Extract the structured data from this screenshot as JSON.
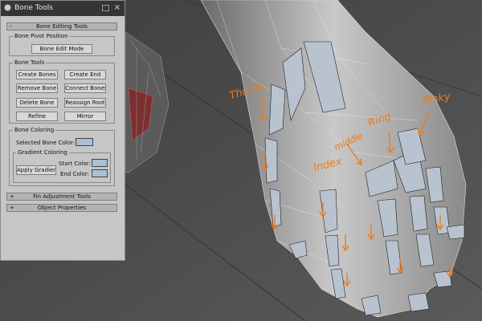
{
  "window": {
    "title": "Bone Tools",
    "close_glyph": "×"
  },
  "rollouts": {
    "bone_editing": {
      "sign": "-",
      "label": "Bone Editing Tools"
    },
    "fin_adjustment": {
      "sign": "+",
      "label": "Fin Adjustment Tools"
    },
    "object_properties": {
      "sign": "+",
      "label": "Object Properties"
    }
  },
  "bone_pivot": {
    "title": "Bone Pivot Position",
    "edit_mode": "Bone Edit Mode"
  },
  "bone_tools": {
    "title": "Bone Tools",
    "create_bones": "Create Bones",
    "create_end": "Create End",
    "remove_bone": "Remove Bone",
    "connect_bones": "Connect Bones",
    "delete_bone": "Delete Bone",
    "reassign_root": "Reassign Root",
    "refine": "Refine",
    "mirror": "Mirror"
  },
  "bone_coloring": {
    "title": "Bone Coloring",
    "selected_label": "Selected Bone Color:",
    "gradient_title": "Gradient Coloring",
    "apply_gradient": "Apply Gradient",
    "start_label": "Start Color:",
    "end_label": "End Color:",
    "selected_color": "#a9bfd6",
    "start_color": "#a9bfd6",
    "end_color": "#a9bfd6"
  },
  "annotations": {
    "thumb": "Thumb",
    "index": "Index",
    "middle": "middle",
    "ring": "Ring",
    "pinky": "Pinky"
  },
  "colors": {
    "annotation": "#f07a14",
    "panel": "#c6c6c6",
    "titlebar": "#353535"
  }
}
